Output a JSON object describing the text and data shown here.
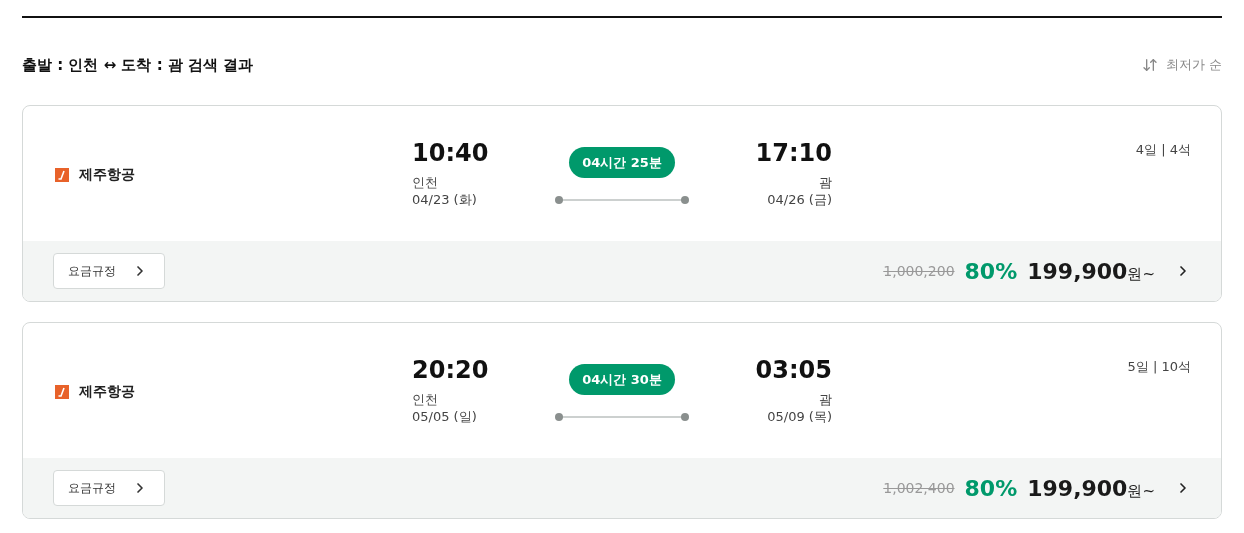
{
  "header": {
    "title": "출발 : 인천 ↔ 도착 : 괌 검색 결과",
    "sort": "최저가 순"
  },
  "flights": [
    {
      "airline": "제주항공",
      "dep_time": "10:40",
      "dep_city": "인천",
      "dep_date": "04/23 (화)",
      "duration": "04시간 25분",
      "arr_time": "17:10",
      "arr_city": "괌",
      "arr_date": "04/26 (금)",
      "stay": "4일 | 4석",
      "fare_rule": "요금규정",
      "original_price": "1,000,200",
      "discount": "80%",
      "price": "199,900",
      "currency": "원~"
    },
    {
      "airline": "제주항공",
      "dep_time": "20:20",
      "dep_city": "인천",
      "dep_date": "05/05 (일)",
      "duration": "04시간 30분",
      "arr_time": "03:05",
      "arr_city": "괌",
      "arr_date": "05/09 (목)",
      "stay": "5일 | 10석",
      "fare_rule": "요금규정",
      "original_price": "1,002,400",
      "discount": "80%",
      "price": "199,900",
      "currency": "원~"
    }
  ]
}
